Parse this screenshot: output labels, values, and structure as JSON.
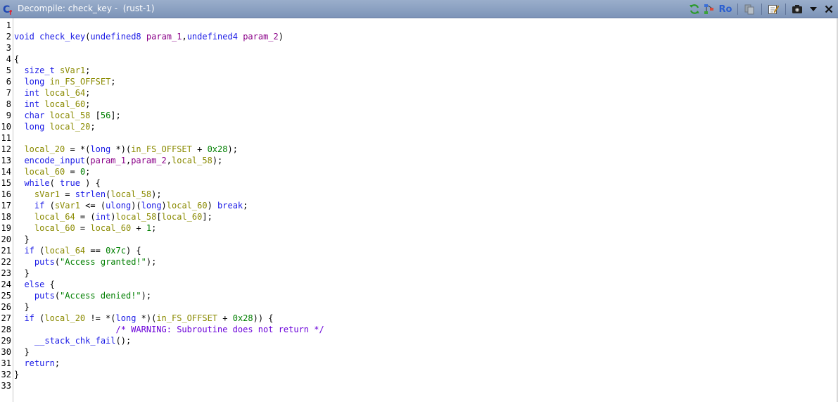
{
  "window": {
    "title": "Decompile: check_key -  (rust-1)",
    "ro_label": "Ro"
  },
  "colors": {
    "keyword": "#1a1ae6",
    "variable": "#8a8a00",
    "parameter": "#8a0088",
    "constant": "#007f00",
    "comment": "#6a00d9",
    "titlebar": "#8ba1c4"
  },
  "icons": [
    "app-decompile-icon",
    "refresh-icon",
    "graph-icon",
    "read-only-ro",
    "copy-icon",
    "edit-icon",
    "snapshot-icon",
    "menu-chevron-down-icon",
    "close-icon"
  ],
  "lines": [
    {
      "n": "1",
      "tokens": []
    },
    {
      "n": "2",
      "tokens": [
        [
          "type",
          "void"
        ],
        [
          "punc",
          " "
        ],
        [
          "fn",
          "check_key"
        ],
        [
          "punc",
          "("
        ],
        [
          "type",
          "undefined8"
        ],
        [
          "punc",
          " "
        ],
        [
          "param",
          "param_1"
        ],
        [
          "punc",
          ","
        ],
        [
          "type",
          "undefined4"
        ],
        [
          "punc",
          " "
        ],
        [
          "param",
          "param_2"
        ],
        [
          "punc",
          ")"
        ]
      ]
    },
    {
      "n": "3",
      "tokens": []
    },
    {
      "n": "4",
      "tokens": [
        [
          "punc",
          "{"
        ]
      ]
    },
    {
      "n": "5",
      "tokens": [
        [
          "punc",
          "  "
        ],
        [
          "type",
          "size_t"
        ],
        [
          "punc",
          " "
        ],
        [
          "var",
          "sVar1"
        ],
        [
          "punc",
          ";"
        ]
      ]
    },
    {
      "n": "6",
      "tokens": [
        [
          "punc",
          "  "
        ],
        [
          "type",
          "long"
        ],
        [
          "punc",
          " "
        ],
        [
          "var",
          "in_FS_OFFSET"
        ],
        [
          "punc",
          ";"
        ]
      ]
    },
    {
      "n": "7",
      "tokens": [
        [
          "punc",
          "  "
        ],
        [
          "type",
          "int"
        ],
        [
          "punc",
          " "
        ],
        [
          "var",
          "local_64"
        ],
        [
          "punc",
          ";"
        ]
      ]
    },
    {
      "n": "8",
      "tokens": [
        [
          "punc",
          "  "
        ],
        [
          "type",
          "int"
        ],
        [
          "punc",
          " "
        ],
        [
          "var",
          "local_60"
        ],
        [
          "punc",
          ";"
        ]
      ]
    },
    {
      "n": "9",
      "tokens": [
        [
          "punc",
          "  "
        ],
        [
          "type",
          "char"
        ],
        [
          "punc",
          " "
        ],
        [
          "var",
          "local_58"
        ],
        [
          "punc",
          " ["
        ],
        [
          "num",
          "56"
        ],
        [
          "punc",
          "];"
        ]
      ]
    },
    {
      "n": "10",
      "tokens": [
        [
          "punc",
          "  "
        ],
        [
          "type",
          "long"
        ],
        [
          "punc",
          " "
        ],
        [
          "var",
          "local_20"
        ],
        [
          "punc",
          ";"
        ]
      ]
    },
    {
      "n": "11",
      "tokens": []
    },
    {
      "n": "12",
      "tokens": [
        [
          "punc",
          "  "
        ],
        [
          "var",
          "local_20"
        ],
        [
          "punc",
          " = *("
        ],
        [
          "type",
          "long"
        ],
        [
          "punc",
          " *)("
        ],
        [
          "var",
          "in_FS_OFFSET"
        ],
        [
          "punc",
          " + "
        ],
        [
          "num",
          "0x28"
        ],
        [
          "punc",
          ");"
        ]
      ]
    },
    {
      "n": "13",
      "tokens": [
        [
          "punc",
          "  "
        ],
        [
          "fn",
          "encode_input"
        ],
        [
          "punc",
          "("
        ],
        [
          "param",
          "param_1"
        ],
        [
          "punc",
          ","
        ],
        [
          "param",
          "param_2"
        ],
        [
          "punc",
          ","
        ],
        [
          "var",
          "local_58"
        ],
        [
          "punc",
          ");"
        ]
      ]
    },
    {
      "n": "14",
      "tokens": [
        [
          "punc",
          "  "
        ],
        [
          "var",
          "local_60"
        ],
        [
          "punc",
          " = "
        ],
        [
          "num",
          "0"
        ],
        [
          "punc",
          ";"
        ]
      ]
    },
    {
      "n": "15",
      "tokens": [
        [
          "punc",
          "  "
        ],
        [
          "kw",
          "while"
        ],
        [
          "punc",
          "( "
        ],
        [
          "kw",
          "true"
        ],
        [
          "punc",
          " ) {"
        ]
      ]
    },
    {
      "n": "16",
      "tokens": [
        [
          "punc",
          "    "
        ],
        [
          "var",
          "sVar1"
        ],
        [
          "punc",
          " = "
        ],
        [
          "fn",
          "strlen"
        ],
        [
          "punc",
          "("
        ],
        [
          "var",
          "local_58"
        ],
        [
          "punc",
          ");"
        ]
      ]
    },
    {
      "n": "17",
      "tokens": [
        [
          "punc",
          "    "
        ],
        [
          "kw",
          "if"
        ],
        [
          "punc",
          " ("
        ],
        [
          "var",
          "sVar1"
        ],
        [
          "punc",
          " <= ("
        ],
        [
          "type",
          "ulong"
        ],
        [
          "punc",
          ")("
        ],
        [
          "type",
          "long"
        ],
        [
          "punc",
          ")"
        ],
        [
          "var",
          "local_60"
        ],
        [
          "punc",
          ") "
        ],
        [
          "kw",
          "break"
        ],
        [
          "punc",
          ";"
        ]
      ]
    },
    {
      "n": "18",
      "tokens": [
        [
          "punc",
          "    "
        ],
        [
          "var",
          "local_64"
        ],
        [
          "punc",
          " = ("
        ],
        [
          "type",
          "int"
        ],
        [
          "punc",
          ")"
        ],
        [
          "var",
          "local_58"
        ],
        [
          "punc",
          "["
        ],
        [
          "var",
          "local_60"
        ],
        [
          "punc",
          "];"
        ]
      ]
    },
    {
      "n": "19",
      "tokens": [
        [
          "punc",
          "    "
        ],
        [
          "var",
          "local_60"
        ],
        [
          "punc",
          " = "
        ],
        [
          "var",
          "local_60"
        ],
        [
          "punc",
          " + "
        ],
        [
          "num",
          "1"
        ],
        [
          "punc",
          ";"
        ]
      ]
    },
    {
      "n": "20",
      "tokens": [
        [
          "punc",
          "  }"
        ]
      ]
    },
    {
      "n": "21",
      "tokens": [
        [
          "punc",
          "  "
        ],
        [
          "kw",
          "if"
        ],
        [
          "punc",
          " ("
        ],
        [
          "var",
          "local_64"
        ],
        [
          "punc",
          " == "
        ],
        [
          "num",
          "0x7c"
        ],
        [
          "punc",
          ") {"
        ]
      ]
    },
    {
      "n": "22",
      "tokens": [
        [
          "punc",
          "    "
        ],
        [
          "fn",
          "puts"
        ],
        [
          "punc",
          "("
        ],
        [
          "str",
          "\"Access granted!\""
        ],
        [
          "punc",
          ");"
        ]
      ]
    },
    {
      "n": "23",
      "tokens": [
        [
          "punc",
          "  }"
        ]
      ]
    },
    {
      "n": "24",
      "tokens": [
        [
          "punc",
          "  "
        ],
        [
          "kw",
          "else"
        ],
        [
          "punc",
          " {"
        ]
      ]
    },
    {
      "n": "25",
      "tokens": [
        [
          "punc",
          "    "
        ],
        [
          "fn",
          "puts"
        ],
        [
          "punc",
          "("
        ],
        [
          "str",
          "\"Access denied!\""
        ],
        [
          "punc",
          ");"
        ]
      ]
    },
    {
      "n": "26",
      "tokens": [
        [
          "punc",
          "  }"
        ]
      ]
    },
    {
      "n": "27",
      "tokens": [
        [
          "punc",
          "  "
        ],
        [
          "kw",
          "if"
        ],
        [
          "punc",
          " ("
        ],
        [
          "var",
          "local_20"
        ],
        [
          "punc",
          " != *("
        ],
        [
          "type",
          "long"
        ],
        [
          "punc",
          " *)("
        ],
        [
          "var",
          "in_FS_OFFSET"
        ],
        [
          "punc",
          " + "
        ],
        [
          "num",
          "0x28"
        ],
        [
          "punc",
          ")) {"
        ]
      ]
    },
    {
      "n": "28",
      "tokens": [
        [
          "punc",
          "                    "
        ],
        [
          "com",
          "/* WARNING: Subroutine does not return */"
        ]
      ]
    },
    {
      "n": "29",
      "tokens": [
        [
          "punc",
          "    "
        ],
        [
          "fn",
          "__stack_chk_fail"
        ],
        [
          "punc",
          "();"
        ]
      ]
    },
    {
      "n": "30",
      "tokens": [
        [
          "punc",
          "  }"
        ]
      ]
    },
    {
      "n": "31",
      "tokens": [
        [
          "punc",
          "  "
        ],
        [
          "kw",
          "return"
        ],
        [
          "punc",
          ";"
        ]
      ]
    },
    {
      "n": "32",
      "tokens": [
        [
          "punc",
          "}"
        ]
      ]
    },
    {
      "n": "33",
      "tokens": []
    }
  ]
}
